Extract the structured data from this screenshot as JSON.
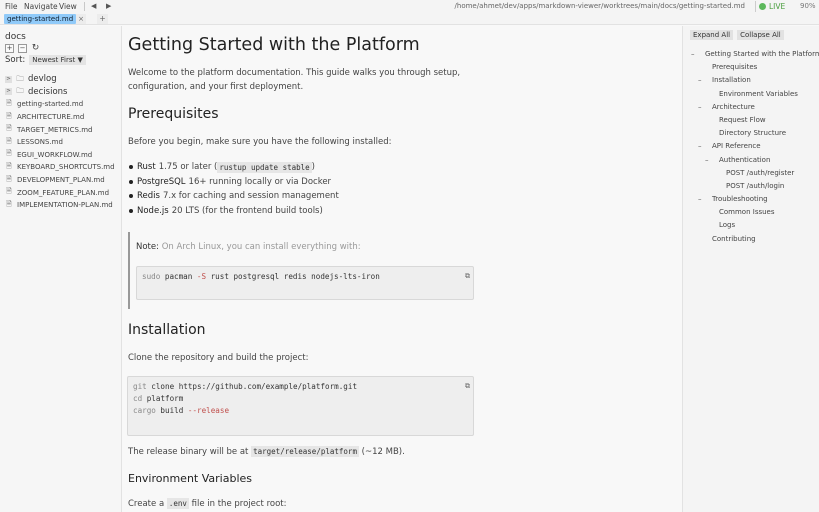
{
  "menubar": {
    "file": "File",
    "navigate": "Navigate",
    "view": "View",
    "back": "◀",
    "forward": "▶",
    "path": "/home/ahmet/dev/apps/markdown-viewer/worktrees/main/docs/getting-started.md",
    "live": "LIVE",
    "zoom": "90%"
  },
  "tabs": {
    "active": "getting-started.md",
    "close": "×",
    "add": "+"
  },
  "sidebar": {
    "title": "docs",
    "tools": {
      "expand": "+",
      "collapse": "−",
      "refresh": "↻"
    },
    "sort_label": "Sort:",
    "sort_value": "Newest First ▼",
    "folders": [
      {
        "name": "devlog"
      },
      {
        "name": "decisions"
      }
    ],
    "files": [
      "getting-started.md",
      "ARCHITECTURE.md",
      "TARGET_METRICS.md",
      "LESSONS.md",
      "EGUI_WORKFLOW.md",
      "KEYBOARD_SHORTCUTS.md",
      "DEVELOPMENT_PLAN.md",
      "ZOOM_FEATURE_PLAN.md",
      "IMPLEMENTATION-PLAN.md"
    ]
  },
  "doc": {
    "title": "Getting Started with the Platform",
    "intro1": "Welcome to the platform documentation. This guide walks you through setup,",
    "intro2": "configuration, and your first deployment.",
    "prereq_heading": "Prerequisites",
    "prereq_intro": "Before you begin, make sure you have the following installed:",
    "bullets": [
      {
        "name": "Rust",
        "text": "1.75 or later (",
        "code": "rustup update stable",
        "after": ")"
      },
      {
        "name": "PostgreSQL",
        "text": "16+ running locally or via Docker"
      },
      {
        "name": "Redis",
        "text": "7.x for caching and session management"
      },
      {
        "name": "Node.js",
        "text": "20 LTS (for the frontend build tools)"
      }
    ],
    "note_label": "Note:",
    "note_text": "On Arch Linux, you can install everything with:",
    "note_code": {
      "cmd": "sudo",
      "rest": " pacman ",
      "flag": "-S",
      "args": " rust postgresql redis nodejs-lts-iron"
    },
    "install_heading": "Installation",
    "install_intro": "Clone the repository and build the project:",
    "install_code": [
      {
        "cmd": "git",
        "rest": " clone https://github.com/example/platform.git"
      },
      {
        "cmd": "cd",
        "rest": " platform"
      },
      {
        "cmd": "cargo",
        "rest": " build ",
        "flag": "--release"
      }
    ],
    "release_before": "The release binary will be at ",
    "release_code": "target/release/platform",
    "release_after": " (~12 MB).",
    "env_heading": "Environment Variables",
    "env_before": "Create a ",
    "env_code": ".env",
    "env_after": " file in the project root:",
    "copy_icon": "⧉"
  },
  "outline": {
    "expand_all": "Expand All",
    "collapse_all": "Collapse All",
    "items": [
      {
        "label": "Getting Started with the Platform",
        "level": 0,
        "dash": "–"
      },
      {
        "label": "Prerequisites",
        "level": 1,
        "dash": ""
      },
      {
        "label": "Installation",
        "level": 1,
        "dash": "–"
      },
      {
        "label": "Environment Variables",
        "level": 2,
        "dash": ""
      },
      {
        "label": "Architecture",
        "level": 1,
        "dash": "–"
      },
      {
        "label": "Request Flow",
        "level": 2,
        "dash": ""
      },
      {
        "label": "Directory Structure",
        "level": 2,
        "dash": ""
      },
      {
        "label": "API Reference",
        "level": 1,
        "dash": "–"
      },
      {
        "label": "Authentication",
        "level": 2,
        "dash": "–"
      },
      {
        "label": "POST /auth/register",
        "level": 3,
        "dash": ""
      },
      {
        "label": "POST /auth/login",
        "level": 3,
        "dash": ""
      },
      {
        "label": "Troubleshooting",
        "level": 1,
        "dash": "–"
      },
      {
        "label": "Common Issues",
        "level": 2,
        "dash": ""
      },
      {
        "label": "Logs",
        "level": 2,
        "dash": ""
      },
      {
        "label": "Contributing",
        "level": 1,
        "dash": ""
      }
    ]
  }
}
